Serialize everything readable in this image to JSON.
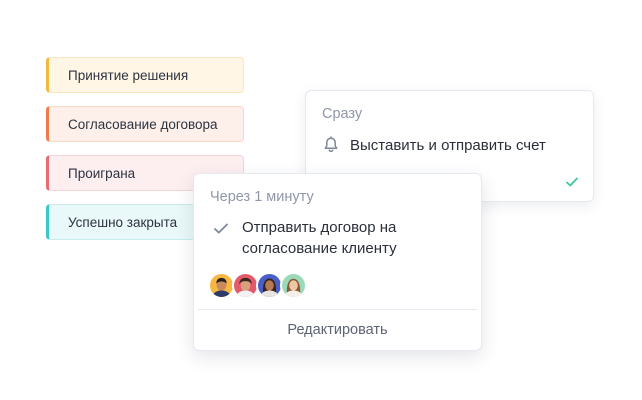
{
  "stages": [
    {
      "label": "Принятие решения",
      "accent": "#f5b83f",
      "bg": "#fff6e6",
      "border": "#fbe6bf"
    },
    {
      "label": "Согласование договора",
      "accent": "#ef7a4b",
      "bg": "#fdf0ea",
      "border": "#f8d7c8"
    },
    {
      "label": "Проиграна",
      "accent": "#e86b74",
      "bg": "#fdeff0",
      "border": "#f6d3d6"
    },
    {
      "label": "Успешно закрыта",
      "accent": "#3cc6c9",
      "bg": "#e9f8f8",
      "border": "#c6eced"
    }
  ],
  "card_now": {
    "caption": "Сразу",
    "task": "Выставить и отправить счет",
    "task_icon": "bell-icon",
    "status_icon": "check-icon",
    "status_color": "#3cc8a0"
  },
  "card_later": {
    "caption": "Через 1 минуту",
    "task": "Отправить договор на согласование клиенту",
    "task_icon": "check-icon",
    "avatar_icons": [
      "avatar-1",
      "avatar-2",
      "avatar-3",
      "avatar-4"
    ],
    "edit_label": "Редактировать"
  }
}
